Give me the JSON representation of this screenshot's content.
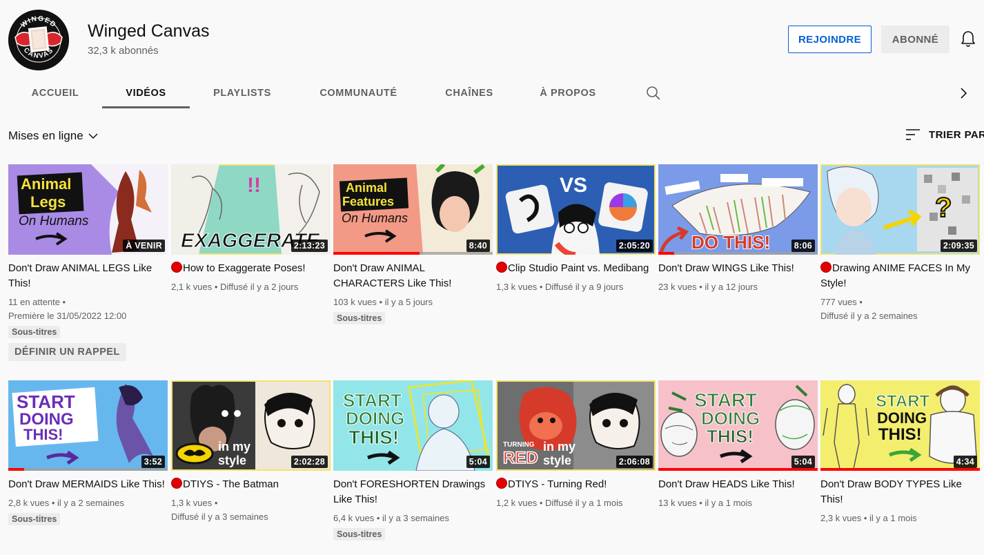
{
  "channel": {
    "name": "Winged Canvas",
    "subscribers": "32,3 k abonnés",
    "join_label": "REJOINDRE",
    "subscribed_label": "ABONNÉ",
    "logo_text_top": "WINGED",
    "logo_text_bottom": "CANVAS"
  },
  "tabs": [
    {
      "label": "ACCUEIL",
      "active": false
    },
    {
      "label": "VIDÉOS",
      "active": true
    },
    {
      "label": "PLAYLISTS",
      "active": false
    },
    {
      "label": "COMMUNAUTÉ",
      "active": false
    },
    {
      "label": "CHAÎNES",
      "active": false
    },
    {
      "label": "À PROPOS",
      "active": false
    }
  ],
  "toolbar": {
    "filter_label": "Mises en ligne",
    "sort_label": "TRIER PAR"
  },
  "colors": {
    "accent_blue": "#065fd4",
    "progress_red": "#ff0000",
    "live_red": "#e20000"
  },
  "videos": [
    {
      "title": "Don't Draw ANIMAL LEGS Like This!",
      "badge": "À VENIR",
      "live": false,
      "meta1": "11 en attente •",
      "meta2": "Première le 31/05/2022 12:00",
      "chip": "Sous-titres",
      "action": "DÉFINIR UN RAPPEL",
      "thumb_text": [
        "Animal",
        "Legs",
        "On Humans"
      ]
    },
    {
      "title": "How to Exaggerate Poses!",
      "badge": "2:13:23",
      "live": true,
      "meta1": "2,1 k vues • Diffusé il y a 2 jours",
      "thumb_text": [
        "EXAGGERATE",
        "!!"
      ]
    },
    {
      "title": "Don't Draw ANIMAL CHARACTERS Like This!",
      "badge": "8:40",
      "live": false,
      "meta1": "103 k vues • il y a 5 jours",
      "chip": "Sous-titres",
      "progress": 0.54,
      "thumb_text": [
        "Animal",
        "Features",
        "On Humans"
      ]
    },
    {
      "title": "Clip Studio Paint vs. Medibang",
      "badge": "2:05:20",
      "live": true,
      "meta1": "1,3 k vues • Diffusé il y a 9 jours",
      "thumb_text": [
        "VS"
      ]
    },
    {
      "title": "Don't Draw WINGS Like This!",
      "badge": "8:06",
      "live": false,
      "meta1": "23 k vues • il y a 12 jours",
      "progress": 0.1,
      "thumb_text": [
        "DO THIS!"
      ]
    },
    {
      "title": "Drawing ANIME FACES In My Style!",
      "badge": "2:09:35",
      "live": true,
      "meta1": "777 vues •",
      "meta2": "Diffusé il y a 2 semaines",
      "thumb_text": [
        "?"
      ]
    },
    {
      "title": "Don't Draw MERMAIDS Like This!",
      "badge": "3:52",
      "live": false,
      "meta1": "2,8 k vues • il y a 2 semaines",
      "chip": "Sous-titres",
      "progress": 0.1,
      "thumb_text": [
        "START",
        "DOING",
        "THIS!"
      ]
    },
    {
      "title": "DTIYS - The Batman",
      "badge": "2:02:28",
      "live": true,
      "meta1": "1,3 k vues •",
      "meta2": "Diffusé il y a 3 semaines",
      "thumb_text": [
        "in my",
        "style"
      ]
    },
    {
      "title": "Don't FORESHORTEN Drawings Like This!",
      "badge": "5:04",
      "live": false,
      "meta1": "6,4 k vues • il y a 3 semaines",
      "chip": "Sous-titres",
      "thumb_text": [
        "START",
        "DOING",
        "THIS!"
      ]
    },
    {
      "title": "DTIYS - Turning Red!",
      "badge": "2:06:08",
      "live": true,
      "meta1": "1,2 k vues • Diffusé il y a 1 mois",
      "thumb_text": [
        "TURNING",
        "RED",
        "in my",
        "style"
      ]
    },
    {
      "title": "Don't Draw HEADS Like This!",
      "badge": "5:04",
      "live": false,
      "meta1": "13 k vues • il y a 1 mois",
      "progress": 1.0,
      "thumb_text": [
        "START",
        "DOING",
        "THIS!"
      ]
    },
    {
      "title": "Don't Draw BODY TYPES Like This!",
      "badge": "4:34",
      "live": false,
      "meta1": "2,3 k vues • il y a 1 mois",
      "progress": 1.0,
      "thumb_text": [
        "START",
        "DOING",
        "THIS!"
      ]
    }
  ]
}
